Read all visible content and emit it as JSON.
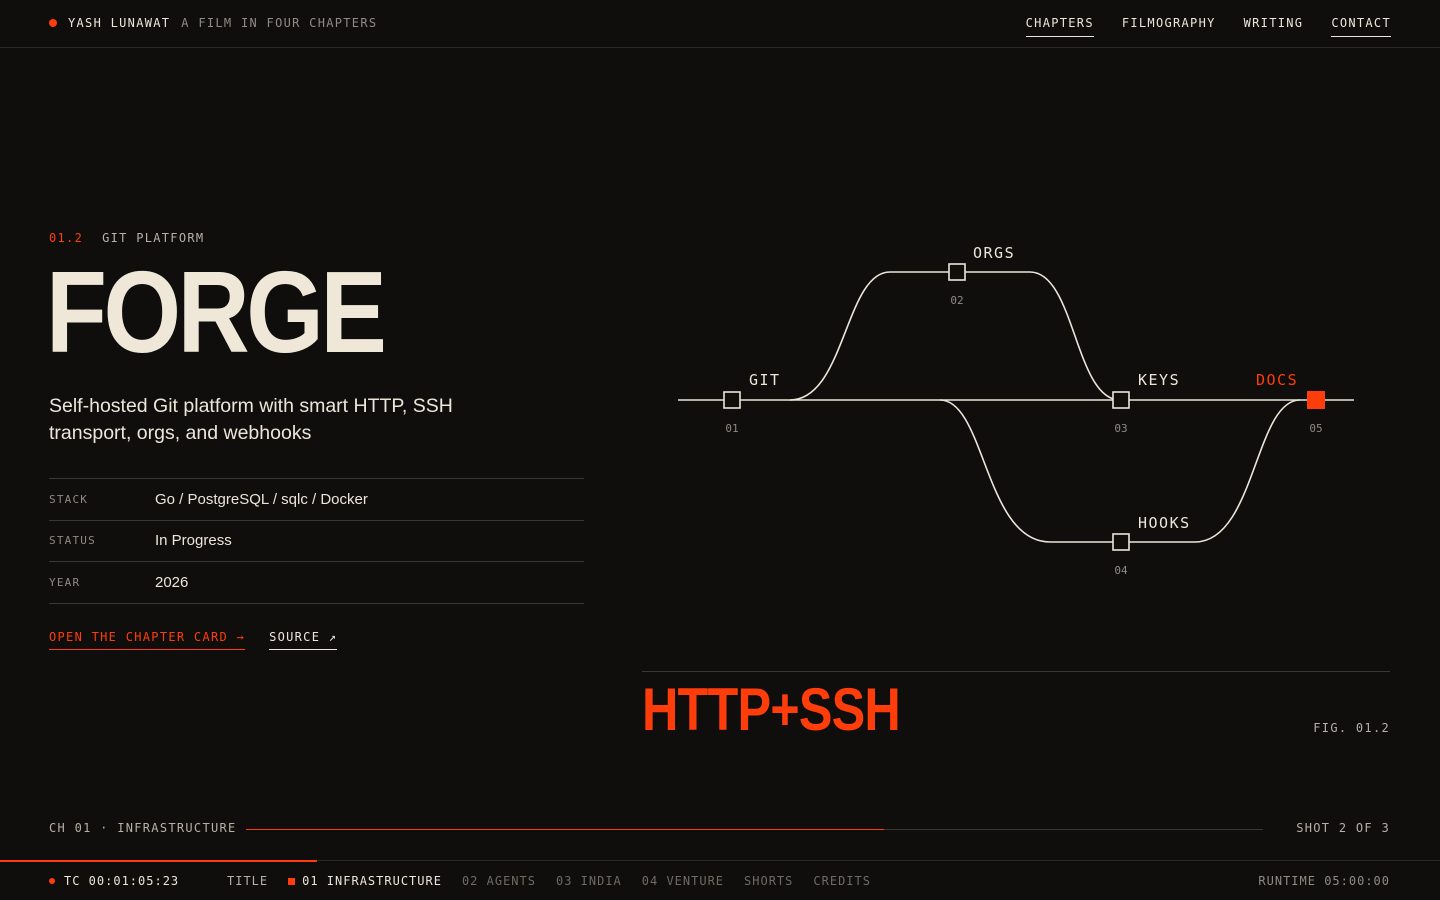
{
  "header": {
    "brand_name": "YASH LUNAWAT",
    "brand_tagline": "A FILM IN FOUR CHAPTERS",
    "nav": [
      {
        "label": "CHAPTERS",
        "active": true
      },
      {
        "label": "FILMOGRAPHY",
        "active": false
      },
      {
        "label": "WRITING",
        "active": false
      },
      {
        "label": "CONTACT",
        "active": true
      }
    ]
  },
  "project": {
    "number": "01.2",
    "category": "GIT PLATFORM",
    "title": "FORGE",
    "tagline": "Self-hosted Git platform with smart HTTP, SSH transport, orgs, and webhooks",
    "specs": [
      {
        "key": "STACK",
        "value": "Go / PostgreSQL / sqlc / Docker"
      },
      {
        "key": "STATUS",
        "value": "In Progress"
      },
      {
        "key": "YEAR",
        "value": "2026"
      }
    ],
    "links": {
      "chapter_card": "OPEN THE CHAPTER CARD →",
      "source": "SOURCE ↗"
    }
  },
  "diagram": {
    "nodes": [
      {
        "label": "GIT",
        "number": "01",
        "highlight": false
      },
      {
        "label": "ORGS",
        "number": "02",
        "highlight": false
      },
      {
        "label": "KEYS",
        "number": "03",
        "highlight": false
      },
      {
        "label": "HOOKS",
        "number": "04",
        "highlight": false
      },
      {
        "label": "DOCS",
        "number": "05",
        "highlight": true
      }
    ],
    "headline": "HTTP+SSH",
    "caption": "FIG. 01.2"
  },
  "progress": {
    "chapter": "CH 01 · INFRASTRUCTURE",
    "shot": "SHOT 2 OF 3",
    "fraction": 0.627
  },
  "footer": {
    "timecode": "TC 00:01:05:23",
    "progress_fraction": 0.22,
    "chapters": [
      {
        "label": "TITLE",
        "state": "title"
      },
      {
        "label": "01 INFRASTRUCTURE",
        "state": "current"
      },
      {
        "label": "02 AGENTS",
        "state": "idle"
      },
      {
        "label": "03 INDIA",
        "state": "idle"
      },
      {
        "label": "04 VENTURE",
        "state": "idle"
      },
      {
        "label": "SHORTS",
        "state": "idle"
      },
      {
        "label": "CREDITS",
        "state": "idle"
      }
    ],
    "runtime": "RUNTIME 05:00:00"
  },
  "colors": {
    "accent": "#ff3d0a",
    "background": "#0f0e0c",
    "foreground": "#ece6da",
    "muted": "#8f8a82"
  }
}
